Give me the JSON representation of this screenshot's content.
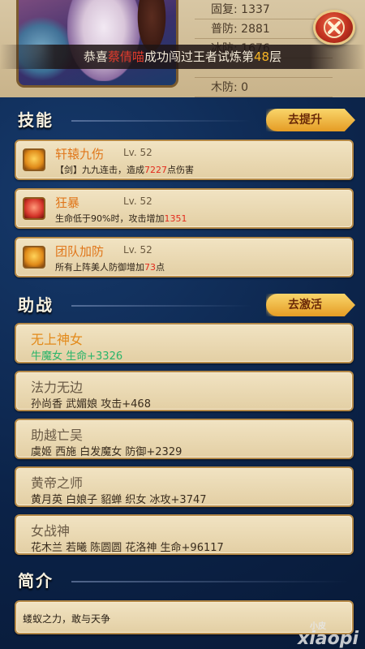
{
  "stats": [
    {
      "label": "固复",
      "value": "1337"
    },
    {
      "label": "普防",
      "value": "2881"
    },
    {
      "label": "冰防",
      "value": "1676"
    },
    {
      "label": "",
      "value": ""
    },
    {
      "label": "木防",
      "value": "0"
    }
  ],
  "banner": {
    "prefix": "恭喜",
    "name": "蔡倩喵",
    "middle": "成功闯过王者试炼第",
    "floor": "48",
    "suffix": "层"
  },
  "sections": {
    "skills": {
      "title": "技能",
      "action": "去提升"
    },
    "assist": {
      "title": "助战",
      "action": "去激活"
    },
    "intro": {
      "title": "简介"
    }
  },
  "skills": [
    {
      "name": "轩辕九伤",
      "level": "Lv. 52",
      "desc_pre": "【剑】九九连击，造成",
      "desc_val": "7227",
      "desc_post": "点伤害"
    },
    {
      "name": "狂暴",
      "level": "Lv. 52",
      "desc_pre": "生命低于90%时，攻击增加",
      "desc_val": "1351",
      "desc_post": ""
    },
    {
      "name": "团队加防",
      "level": "Lv. 52",
      "desc_pre": "所有上阵美人防御增加",
      "desc_val": "73",
      "desc_post": "点"
    }
  ],
  "assists": [
    {
      "name": "无上神女",
      "desc": "牛魔女 生命+3326"
    },
    {
      "name": "法力无边",
      "desc": "孙尚香 武媚娘 攻击+468"
    },
    {
      "name": "助越亡吴",
      "desc": "虞姬 西施 白发魔女 防御+2329"
    },
    {
      "name": "黄帝之师",
      "desc": "黄月英 白娘子 貂蝉 织女 冰攻+3747"
    },
    {
      "name": "女战神",
      "desc": "花木兰 若曦 陈圆圆 花洛神 生命+96117"
    }
  ],
  "intro": {
    "text": "蝼蚁之力，敢与天争"
  },
  "watermark": {
    "small": "小皮",
    "big": "xiaopi"
  }
}
